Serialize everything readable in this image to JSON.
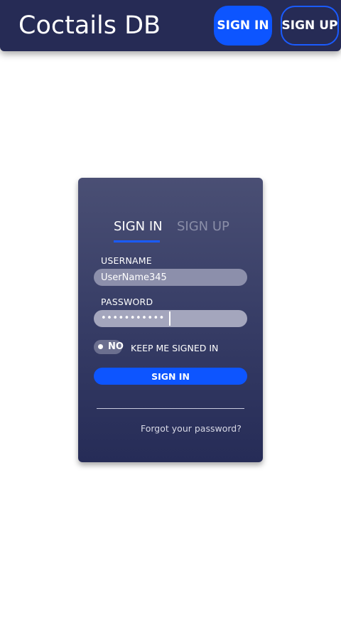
{
  "header": {
    "brand": "Coctails DB",
    "sign_in_label": "SIGN IN",
    "sign_up_label": "SIGN UP"
  },
  "form": {
    "tabs": [
      {
        "label": "SIGN IN",
        "active": true
      },
      {
        "label": "SIGN UP",
        "active": false
      }
    ],
    "username_label": "USERNAME",
    "username_value": "UserName345",
    "password_label": "PASSWORD",
    "password_value": "•••••••••••",
    "keep_signed_in_toggle": "NO",
    "keep_signed_in_label": "KEEP ME SIGNED IN",
    "submit_label": "SIGN IN",
    "forgot_link": "Forgot your password?"
  },
  "colors": {
    "navbar": "#262b55",
    "accent": "#0d55ff",
    "card_top": "#4a4f74",
    "card_bottom": "#262c57"
  }
}
